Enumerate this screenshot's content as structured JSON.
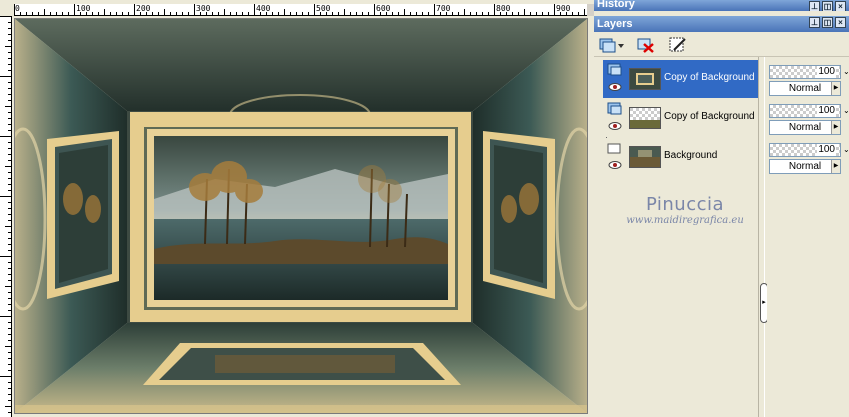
{
  "ruler": {
    "labels": [
      "0",
      "100",
      "200",
      "300",
      "400",
      "500",
      "600",
      "700",
      "800",
      "900"
    ]
  },
  "palettes": {
    "history_title": "History",
    "layers_title": "Layers"
  },
  "layers": [
    {
      "name": "Copy of Background",
      "opacity": "100",
      "blend": "Normal",
      "selected": true
    },
    {
      "name": "Copy of Background",
      "opacity": "100",
      "blend": "Normal",
      "selected": false
    },
    {
      "name": "Background",
      "opacity": "100",
      "blend": "Normal",
      "selected": false
    }
  ],
  "watermark": {
    "name": "Pinuccia",
    "url": "www.maidiregrafica.eu"
  },
  "colors": {
    "selection": "#316ac5",
    "titlebar": "#4a74b8",
    "panel_bg": "#ece9d8",
    "frame_gold": "#e6cd8e"
  },
  "icons": [
    "new-layer-icon",
    "delete-layer-icon",
    "layer-properties-icon",
    "visibility-eye-icon",
    "raster-layer-icon",
    "spinner-icon",
    "dropdown-arrow-icon"
  ]
}
